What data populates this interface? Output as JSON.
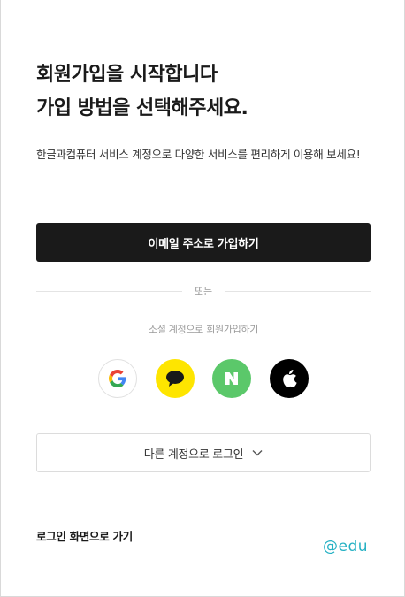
{
  "heading": {
    "line1": "회원가입을 시작합니다",
    "line2": "가입 방법을 선택해주세요."
  },
  "description": "한글과컴퓨터 서비스 계정으로 다양한 서비스를 편리하게 이용해 보세요!",
  "email_signup_button": "이메일 주소로 가입하기",
  "divider_text": "또는",
  "social_label": "소셜 계정으로 회원가입하기",
  "social_buttons": [
    {
      "icon": "google-icon"
    },
    {
      "icon": "kakao-icon"
    },
    {
      "icon": "naver-icon"
    },
    {
      "icon": "apple-icon"
    }
  ],
  "other_account_button": "다른 계정으로 로그인",
  "login_link": "로그인 화면으로 가기",
  "watermark": "@edu",
  "colors": {
    "primary_button": "#1a1a1a",
    "kakao": "#fee500",
    "naver": "#5bc86a",
    "apple": "#000000",
    "watermark": "#26b1c4"
  }
}
